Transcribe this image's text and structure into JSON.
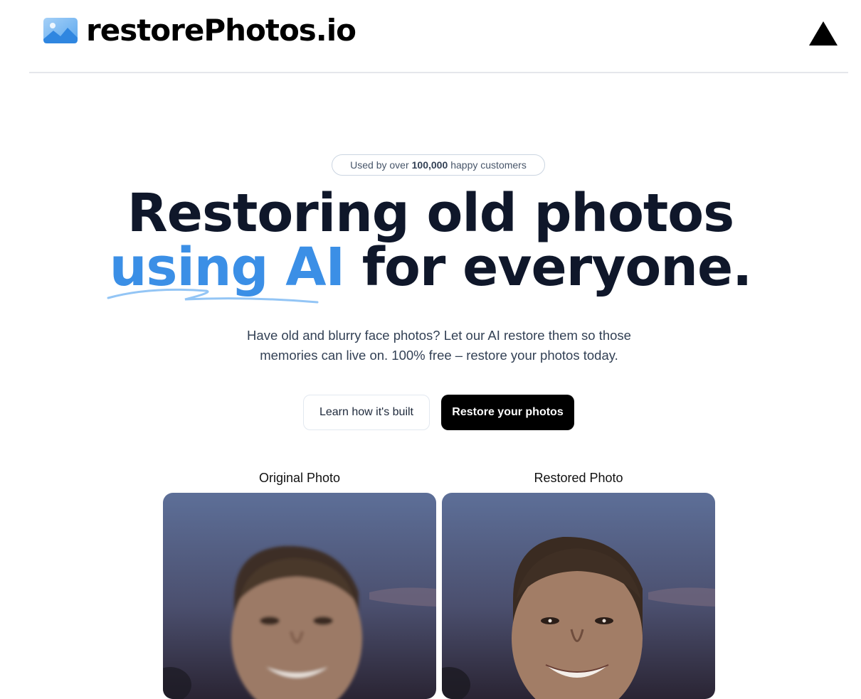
{
  "header": {
    "logo_text": "restorePhotos.io",
    "logo_icon": "photo-icon",
    "github_icon": "vercel-triangle-icon"
  },
  "badge": {
    "prefix": "Used by over",
    "count": "100,000",
    "suffix": "happy customers"
  },
  "hero": {
    "title_line1": "Restoring old photos",
    "title_accent": "using AI",
    "title_rest": "for everyone.",
    "subtitle": "Have old and blurry face photos? Let our AI restore them so those memories can live on. 100% free – restore your photos today."
  },
  "buttons": {
    "learn_label": "Learn how it's built",
    "restore_label": "Restore your photos"
  },
  "comparison": {
    "original_label": "Original Photo",
    "restored_label": "Restored Photo"
  },
  "colors": {
    "accent": "#3b8fe6",
    "heading": "#0f172a",
    "button_dark": "#000000"
  }
}
